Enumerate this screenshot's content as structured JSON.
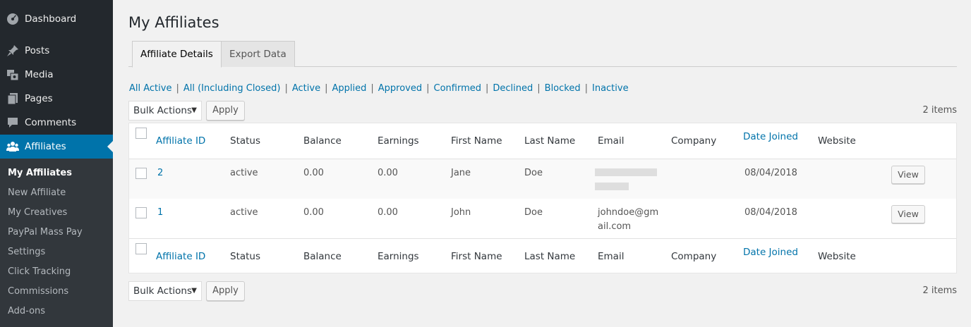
{
  "sidebar": {
    "items": [
      {
        "label": "Dashboard",
        "icon": "dashboard-icon"
      },
      {
        "label": "Posts",
        "icon": "pin-icon"
      },
      {
        "label": "Media",
        "icon": "media-icon"
      },
      {
        "label": "Pages",
        "icon": "pages-icon"
      },
      {
        "label": "Comments",
        "icon": "comment-icon"
      },
      {
        "label": "Affiliates",
        "icon": "groups-icon"
      }
    ],
    "submenu": [
      "My Affiliates",
      "New Affiliate",
      "My Creatives",
      "PayPal Mass Pay",
      "Settings",
      "Click Tracking",
      "Commissions",
      "Add-ons"
    ]
  },
  "page": {
    "title": "My Affiliates",
    "tabs": [
      "Affiliate Details",
      "Export Data"
    ]
  },
  "filters": [
    "All Active",
    "All (Including Closed)",
    "Active",
    "Applied",
    "Approved",
    "Confirmed",
    "Declined",
    "Blocked",
    "Inactive"
  ],
  "tablenav": {
    "bulk_actions": "Bulk Actions",
    "apply": "Apply",
    "count": "2 items"
  },
  "table": {
    "columns": [
      "Affiliate ID",
      "Status",
      "Balance",
      "Earnings",
      "First Name",
      "Last Name",
      "Email",
      "Company",
      "Date Joined",
      "Website"
    ],
    "rows": [
      {
        "id": "2",
        "status": "active",
        "balance": "0.00",
        "earnings": "0.00",
        "first": "Jane",
        "last": "Doe",
        "email_line1": "",
        "email_line2": "",
        "company": "",
        "date": "08/04/2018",
        "website": "",
        "action": "View"
      },
      {
        "id": "1",
        "status": "active",
        "balance": "0.00",
        "earnings": "0.00",
        "first": "John",
        "last": "Doe",
        "email_line1": "johndoe@gm",
        "email_line2": "ail.com",
        "company": "",
        "date": "08/04/2018",
        "website": "",
        "action": "View"
      }
    ]
  },
  "colors": {
    "sidebar_bg": "#23282d",
    "accent": "#0073aa",
    "submenu_bg": "#32373c"
  }
}
